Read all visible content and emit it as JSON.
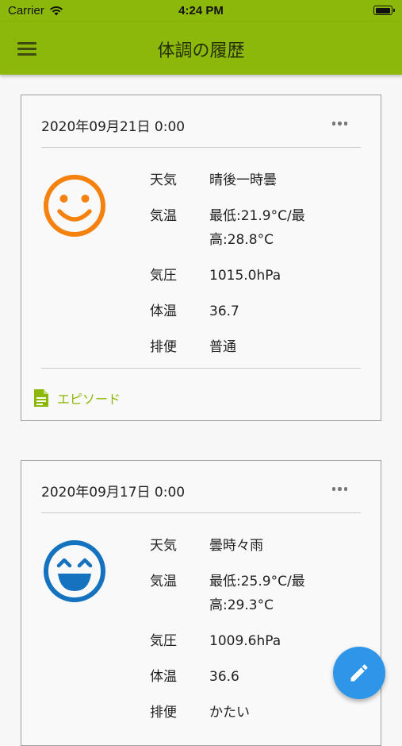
{
  "status_bar": {
    "carrier": "Carrier",
    "time": "4:24 PM"
  },
  "app_bar": {
    "title": "体調の履歴",
    "menu_icon": "hamburger-menu-icon"
  },
  "colors": {
    "accent": "#8cb80c",
    "fab": "#2e96e8",
    "face_good": "#f5820f",
    "face_great": "#1572bf"
  },
  "records": [
    {
      "date": "2020年09月21日 0:00",
      "mood_icon": "smiley-face-orange-icon",
      "rows": [
        {
          "label": "天気",
          "value": "晴後一時曇"
        },
        {
          "label": "気温",
          "value": "最低:21.9°C/最高:28.8°C"
        },
        {
          "label": "気圧",
          "value": "1015.0hPa"
        },
        {
          "label": "体温",
          "value": "36.7"
        },
        {
          "label": "排便",
          "value": "普通"
        }
      ],
      "episode_label": "エピソード"
    },
    {
      "date": "2020年09月17日 0:00",
      "mood_icon": "grinning-face-blue-icon",
      "rows": [
        {
          "label": "天気",
          "value": "曇時々雨"
        },
        {
          "label": "気温",
          "value": "最低:25.9°C/最高:29.3°C"
        },
        {
          "label": "気圧",
          "value": "1009.6hPa"
        },
        {
          "label": "体温",
          "value": "36.6"
        },
        {
          "label": "排便",
          "value": "かたい"
        }
      ]
    }
  ],
  "fab_icon": "pencil-edit-icon"
}
